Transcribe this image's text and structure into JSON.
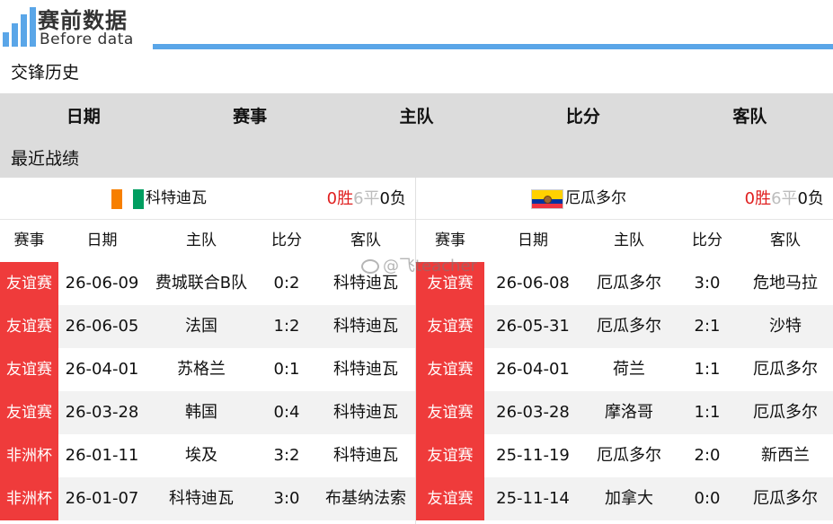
{
  "brand": {
    "title": "赛前数据",
    "subtitle": "Before data",
    "accent_color": "#5aa6e8"
  },
  "section_title": "交锋历史",
  "header_columns": [
    "日期",
    "赛事",
    "主队",
    "比分",
    "客队"
  ],
  "recent_title": "最近战绩",
  "column_headers": [
    "赛事",
    "日期",
    "主队",
    "比分",
    "客队"
  ],
  "watermark": "@飞teacher",
  "left": {
    "team": "科特迪瓦",
    "flag_icon": "cote-divoire-flag-icon",
    "record": {
      "win": "0胜",
      "draw": "6平",
      "loss": "0负"
    },
    "matches": [
      {
        "comp": "友谊赛",
        "date": "26-06-09",
        "home": "费城联合B队",
        "score": "0:2",
        "away": "科特迪瓦"
      },
      {
        "comp": "友谊赛",
        "date": "26-06-05",
        "home": "法国",
        "score": "1:2",
        "away": "科特迪瓦"
      },
      {
        "comp": "友谊赛",
        "date": "26-04-01",
        "home": "苏格兰",
        "score": "0:1",
        "away": "科特迪瓦"
      },
      {
        "comp": "友谊赛",
        "date": "26-03-28",
        "home": "韩国",
        "score": "0:4",
        "away": "科特迪瓦"
      },
      {
        "comp": "非洲杯",
        "date": "26-01-11",
        "home": "埃及",
        "score": "3:2",
        "away": "科特迪瓦"
      },
      {
        "comp": "非洲杯",
        "date": "26-01-07",
        "home": "科特迪瓦",
        "score": "3:0",
        "away": "布基纳法索"
      }
    ]
  },
  "right": {
    "team": "厄瓜多尔",
    "flag_icon": "ecuador-flag-icon",
    "record": {
      "win": "0胜",
      "draw": "6平",
      "loss": "0负"
    },
    "matches": [
      {
        "comp": "友谊赛",
        "date": "26-06-08",
        "home": "厄瓜多尔",
        "score": "3:0",
        "away": "危地马拉"
      },
      {
        "comp": "友谊赛",
        "date": "26-05-31",
        "home": "厄瓜多尔",
        "score": "2:1",
        "away": "沙特"
      },
      {
        "comp": "友谊赛",
        "date": "26-04-01",
        "home": "荷兰",
        "score": "1:1",
        "away": "厄瓜多尔"
      },
      {
        "comp": "友谊赛",
        "date": "26-03-28",
        "home": "摩洛哥",
        "score": "1:1",
        "away": "厄瓜多尔"
      },
      {
        "comp": "友谊赛",
        "date": "25-11-19",
        "home": "厄瓜多尔",
        "score": "2:0",
        "away": "新西兰"
      },
      {
        "comp": "友谊赛",
        "date": "25-11-14",
        "home": "加拿大",
        "score": "0:0",
        "away": "厄瓜多尔"
      }
    ]
  }
}
